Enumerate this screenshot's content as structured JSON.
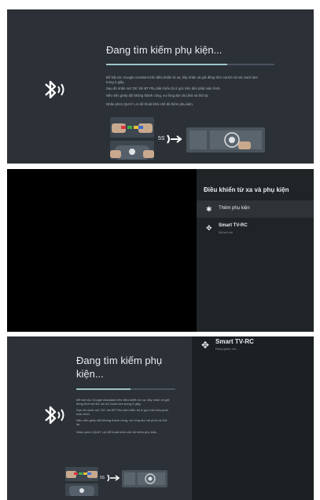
{
  "screen1": {
    "title": "Đang tìm kiếm phụ kiện...",
    "progress": 0.72,
    "instructions": [
      "Để bật mic Google Assistant trên điều khiển từ xa, hãy nhấn và giữ đồng thời nút Đỏ và nút Xanh lam trong 5 giây.",
      "Sau đó nhấn nút 'OK' khi BT Phụ kiện hiển thị ở góc trên bên phải màn hình.",
      "Nếu việc ghép đôi không thành công, vui lòng đợi vài phút và thử lại."
    ],
    "back_hint": "Nhấn phím QUAY LẠI để thoát khỏi chế độ thêm phụ kiện.",
    "hold_time": "5S"
  },
  "screen2": {
    "menu_title": "Điều khiển từ xa và phụ kiện",
    "items": [
      {
        "icon": "bluetooth-icon",
        "label": "Thêm phụ kiện",
        "sub": ""
      },
      {
        "icon": "gamepad-icon",
        "label": "Smart TV-RC",
        "sub": "Đã kết nối"
      }
    ]
  },
  "screen3": {
    "title": "Đang tìm kiếm phụ kiện...",
    "progress": 0.55,
    "instructions": [
      "Để bật mic Google Assistant trên điều khiển từ xa, hãy nhấn và giữ đồng thời nút Đỏ và nút Xanh lam trong 5 giây.",
      "Sau đó nhấn nút 'OK' khi BT Phụ kiện hiển thị ở góc trên bên phải màn hình.",
      "Nếu việc ghép đôi không thành công, vui lòng đợi vài phút và thử lại."
    ],
    "back_hint": "Nhấn phím QUAY LẠI để thoát khỏi chế độ thêm phụ kiện.",
    "hold_time": "5S",
    "found_device": {
      "label": "Smart TV-RC",
      "sub": "Đang ghép nối..."
    }
  },
  "colors": {
    "panel_bg": "#2b3136",
    "accent": "#9fc3c8",
    "red_button": "#d9363e",
    "blue_button": "#3a6bd6",
    "green_button": "#3fae49",
    "yellow_button": "#e8c23a"
  }
}
